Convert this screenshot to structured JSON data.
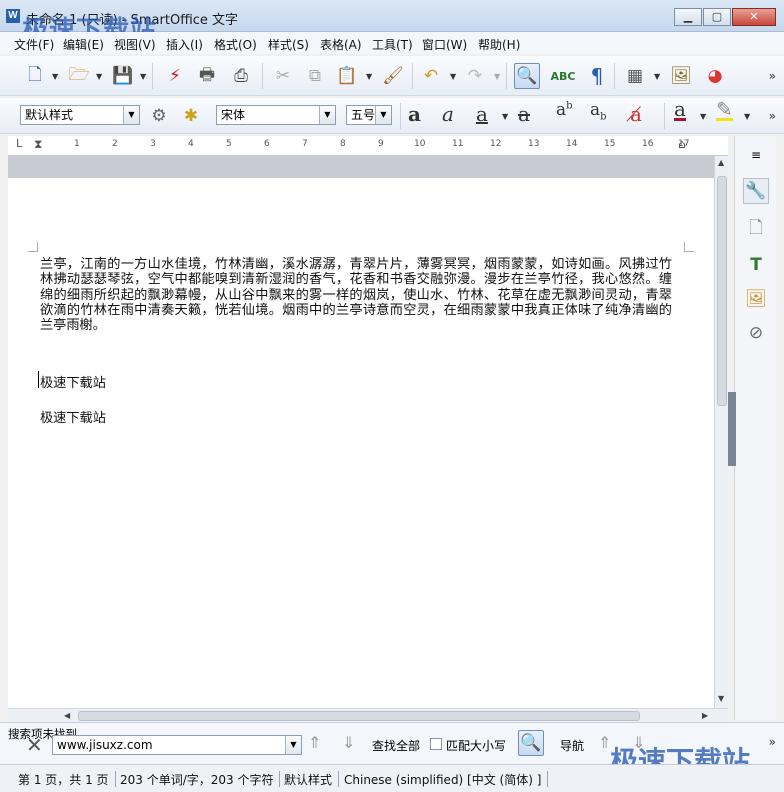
{
  "window": {
    "title": "未命名 1 (只读) - SmartOffice 文字",
    "watermark": "极速下载站",
    "min": "0",
    "max": "1",
    "close": "r"
  },
  "menu": [
    "文件(F)",
    "编辑(E)",
    "视图(V)",
    "插入(I)",
    "格式(O)",
    "样式(S)",
    "表格(A)",
    "工具(T)",
    "窗口(W)",
    "帮助(H)"
  ],
  "format": {
    "style": "默认样式",
    "font": "宋体",
    "size": "五号"
  },
  "ruler": {
    "numbers": [
      "1",
      "1",
      "2",
      "3",
      "4",
      "5",
      "6",
      "7",
      "8",
      "9",
      "10",
      "11",
      "12",
      "13",
      "14",
      "15",
      "16",
      "17"
    ]
  },
  "document": {
    "paragraph": "兰亭，江南的一方山水佳境，竹林清幽，溪水潺潺，青翠片片，薄雾冥冥，烟雨蒙蒙，如诗如画。风拂过竹林拂动瑟瑟琴弦，空气中都能嗅到清新湿润的香气，花香和书香交融弥漫。漫步在兰亭竹径，我心悠然。缠绵的细雨所织起的飘渺幕幔，从山谷中飘来的雾一样的烟岚，使山水、竹林、花草在虚无飘渺间灵动，青翠欲滴的竹林在雨中清奏天籁，恍若仙境。烟雨中的兰亭诗意而空灵，在细雨蒙蒙中我真正体味了纯净清幽的兰亭雨榭。",
    "line1": "极速下载站",
    "line2": "极速下载站"
  },
  "findbar": {
    "status": "搜索项未找到",
    "query": "www.jisuxz.com",
    "find_all": "查找全部",
    "match_case": "匹配大小写",
    "navigate": "导航"
  },
  "status": {
    "page": "第 1 页，共 1 页",
    "words": "203 个单词/字，203 个字符",
    "style": "默认样式",
    "language": "Chinese (simplified) [中文 (简体) ]"
  }
}
